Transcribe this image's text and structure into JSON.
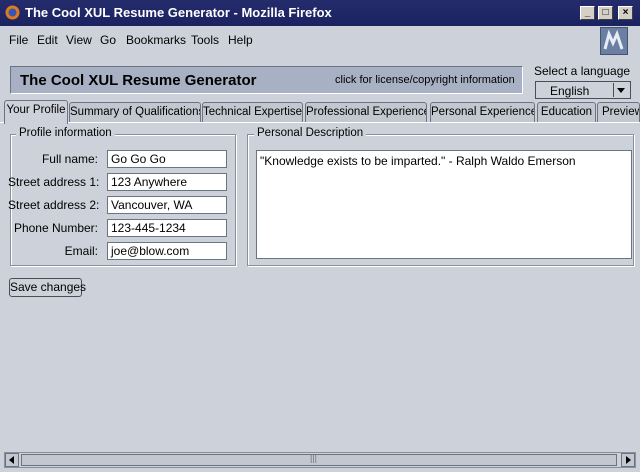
{
  "window": {
    "title": "The Cool XUL Resume Generator - Mozilla Firefox",
    "controls": {
      "minimize": "_",
      "maximize": "□",
      "close": "×"
    }
  },
  "menu": [
    "File",
    "Edit",
    "View",
    "Go",
    "Bookmarks",
    "Tools",
    "Help"
  ],
  "header": {
    "app_title": "The Cool XUL Resume Generator",
    "license_link": "click for license/copyright information",
    "language_label": "Select a language",
    "language_selected": "English"
  },
  "tabs": [
    {
      "label": "Your Profile",
      "active": true
    },
    {
      "label": "Summary of Qualifications"
    },
    {
      "label": "Technical Expertise"
    },
    {
      "label": "Professional Experience"
    },
    {
      "label": "Personal Experience"
    },
    {
      "label": "Education"
    },
    {
      "label": "Preview"
    }
  ],
  "profile": {
    "caption": "Profile information",
    "fields": [
      {
        "label": "Full name:",
        "value": "Go Go Go"
      },
      {
        "label": "Street address 1:",
        "value": "123 Anywhere"
      },
      {
        "label": "Street address 2:",
        "value": "Vancouver, WA"
      },
      {
        "label": "Phone Number:",
        "value": "123-445-1234"
      },
      {
        "label": "Email:",
        "value": "joe@blow.com"
      }
    ]
  },
  "personal_description": {
    "caption": "Personal Description",
    "text": "\"Knowledge exists to be imparted.\" - Ralph Waldo Emerson"
  },
  "save_button": "Save changes",
  "scrollbar_grip": "|||",
  "icons": {
    "app": "firefox-icon",
    "throbber": "mozilla-m-icon",
    "dropdown": "chevron-down-icon",
    "scroll_left": "arrow-left-icon",
    "scroll_right": "arrow-right-icon"
  },
  "colors": {
    "titlebar": "#242c6c",
    "background": "#cdd2da",
    "banner": "#a7b1c3"
  }
}
